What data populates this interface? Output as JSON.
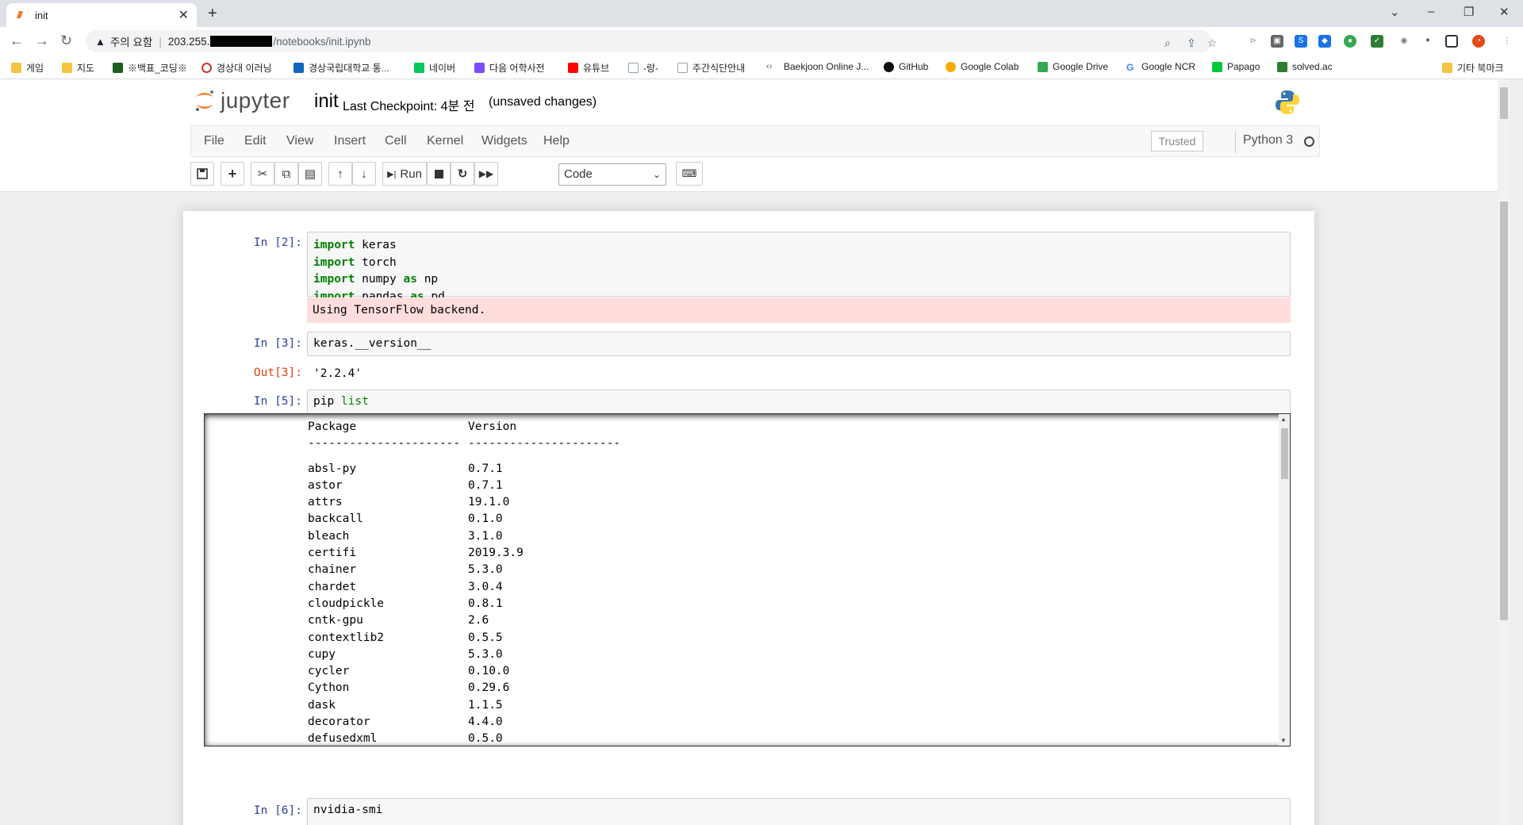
{
  "browser": {
    "tab_title": "init",
    "address": {
      "warning": "주의 요함",
      "host": "203.255.",
      "path": "/notebooks/init.ipynb"
    },
    "bookmarks": [
      "게임",
      "지도",
      "※백표_코딩※",
      "경상대 이러닝",
      "경상국립대학교 통...",
      "네이버",
      "다음 어학사전",
      "유튜브",
      "-랑-",
      "주간식단안내",
      "Baekjoon Online J...",
      "GitHub",
      "Google Colab",
      "Google Drive",
      "Google NCR",
      "Papago",
      "solved.ac"
    ],
    "other_bookmarks": "기타 북마크"
  },
  "jupyter": {
    "logo_text": "jupyter",
    "notebook_name": "init",
    "checkpoint": "Last Checkpoint: 4분 전",
    "unsaved": "(unsaved changes)",
    "menu": [
      "File",
      "Edit",
      "View",
      "Insert",
      "Cell",
      "Kernel",
      "Widgets",
      "Help"
    ],
    "trusted": "Trusted",
    "kernel": "Python 3",
    "toolbar": {
      "run_label": "Run",
      "cell_type": "Code"
    }
  },
  "cells": {
    "c1": {
      "prompt": "In [2]:",
      "lines": [
        {
          "kw": "import",
          "rest": " keras"
        },
        {
          "kw": "import",
          "rest": " torch"
        },
        {
          "kw": "import",
          "rest": " numpy ",
          "kw2": "as",
          "rest2": " np"
        },
        {
          "kw": "import",
          "rest": " pandas ",
          "kw2": "as",
          "rest2": " pd"
        }
      ],
      "stderr": "Using TensorFlow backend."
    },
    "c2": {
      "prompt": "In [3]:",
      "code": "keras.__version__",
      "out_prompt": "Out[3]:",
      "output": "'2.2.4'"
    },
    "c3": {
      "prompt": "In [5]:",
      "code_a": "pip ",
      "code_b": "list",
      "header": [
        "Package",
        "Version"
      ],
      "dashes": [
        "----------------------",
        "----------------------"
      ],
      "packages": [
        [
          "absl-py",
          "0.7.1"
        ],
        [
          "astor",
          "0.7.1"
        ],
        [
          "attrs",
          "19.1.0"
        ],
        [
          "backcall",
          "0.1.0"
        ],
        [
          "bleach",
          "3.1.0"
        ],
        [
          "certifi",
          "2019.3.9"
        ],
        [
          "chainer",
          "5.3.0"
        ],
        [
          "chardet",
          "3.0.4"
        ],
        [
          "cloudpickle",
          "0.8.1"
        ],
        [
          "cntk-gpu",
          "2.6"
        ],
        [
          "contextlib2",
          "0.5.5"
        ],
        [
          "cupy",
          "5.3.0"
        ],
        [
          "cycler",
          "0.10.0"
        ],
        [
          "Cython",
          "0.29.6"
        ],
        [
          "dask",
          "1.1.5"
        ],
        [
          "decorator",
          "4.4.0"
        ],
        [
          "defusedxml",
          "0.5.0"
        ]
      ]
    },
    "c4": {
      "prompt": "In [6]:",
      "code": "nvidia-smi"
    }
  }
}
